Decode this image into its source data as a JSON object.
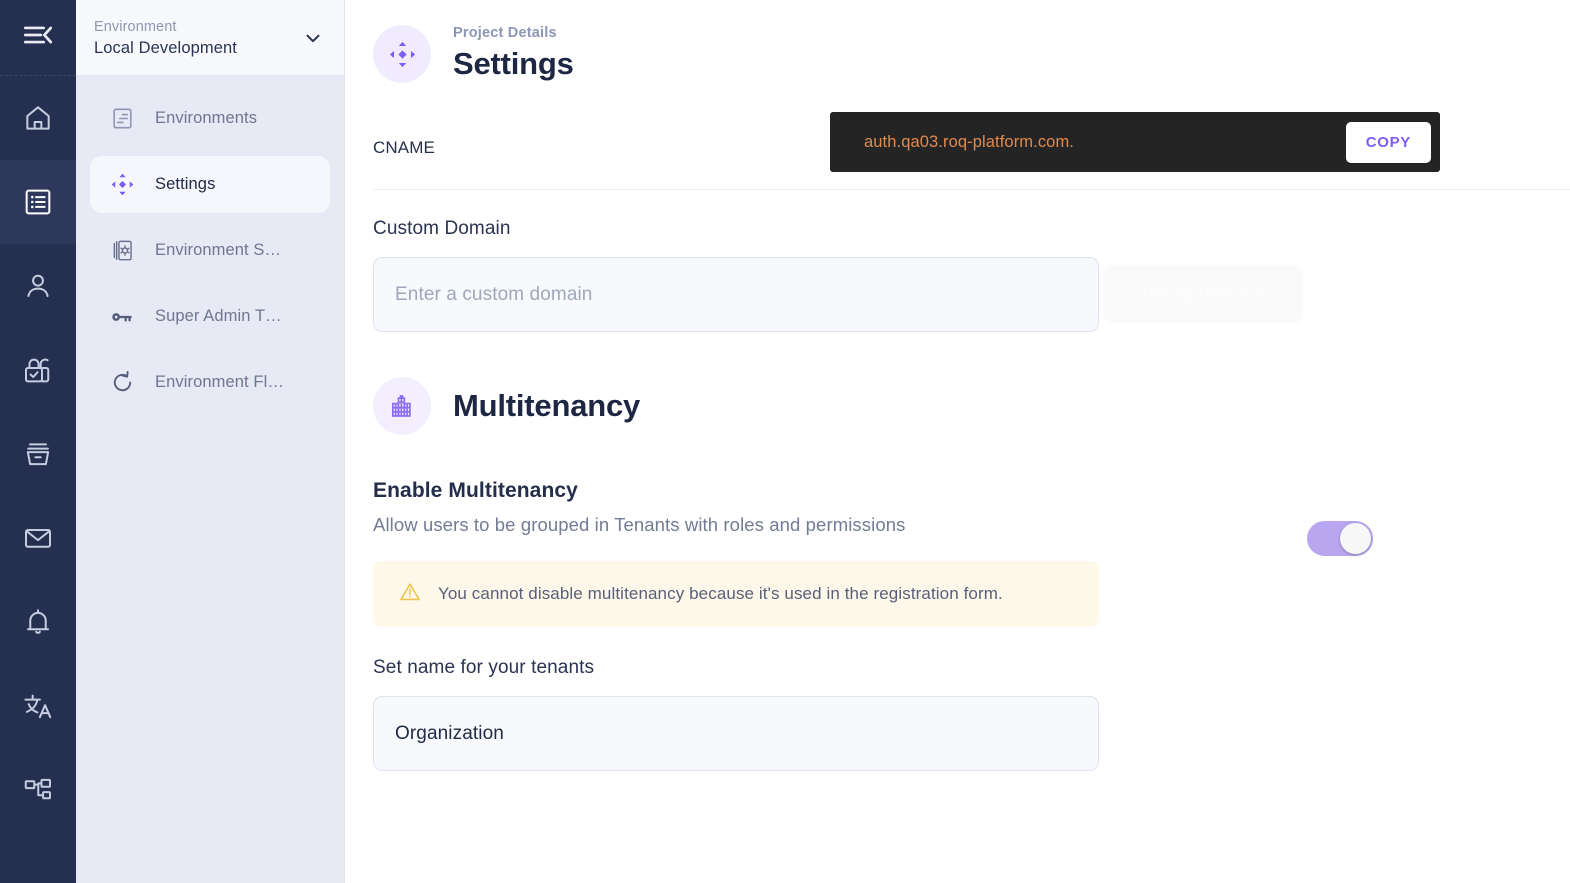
{
  "rail": {
    "collapse": {
      "name": "menu-collapse-icon"
    },
    "items": [
      {
        "icon": "home-icon",
        "active": false
      },
      {
        "icon": "list-icon",
        "active": true
      },
      {
        "icon": "user-icon",
        "active": false
      },
      {
        "icon": "lock-check-icon",
        "active": false
      },
      {
        "icon": "archive-icon",
        "active": false
      },
      {
        "icon": "mail-icon",
        "active": false
      },
      {
        "icon": "bell-icon",
        "active": false
      },
      {
        "icon": "translate-icon",
        "active": false
      },
      {
        "icon": "sitemap-icon",
        "active": false
      }
    ]
  },
  "sidebar": {
    "env_label": "Environment",
    "env_value": "Local Development",
    "items": [
      {
        "label": "Environments",
        "icon": "document-list-icon",
        "active": false
      },
      {
        "label": "Settings",
        "icon": "settings-move-icon",
        "active": true
      },
      {
        "label": "Environment S…",
        "icon": "environment-settings-icon",
        "active": false
      },
      {
        "label": "Super Admin T…",
        "icon": "key-icon",
        "active": false
      },
      {
        "label": "Environment Fl…",
        "icon": "refresh-icon",
        "active": false
      }
    ]
  },
  "page": {
    "eyebrow": "Project Details",
    "title": "Settings",
    "icon": "settings-move-icon"
  },
  "cname": {
    "label": "CNAME",
    "value": "auth.qa03.roq-platform.com.",
    "copy_label": "COPY"
  },
  "custom_domain": {
    "label": "Custom Domain",
    "placeholder": "Enter a custom domain",
    "value": "",
    "verify_label": "Verify Domain",
    "verify_disabled": true
  },
  "multitenancy": {
    "title": "Multitenancy",
    "icon": "building-icon",
    "enable_title": "Enable Multitenancy",
    "enable_subtitle": "Allow users to be grouped in Tenants with roles and permissions",
    "toggle_on": true,
    "alert_icon": "warning-triangle-icon",
    "alert_text": "You cannot disable multitenancy because it's used in the registration form.",
    "tenant_name_label": "Set name for your tenants",
    "tenant_name_value": "Organization",
    "tenant_name_placeholder": "Organization"
  },
  "colors": {
    "rail_bg": "#252f4f",
    "sidebar_bg": "#e7eaf4",
    "accent_purple": "#7c5cf5",
    "cname_bg": "#242424",
    "cname_text": "#e08a4e",
    "alert_bg": "#fdf8e9",
    "toggle_on": "#b9a6f0"
  }
}
